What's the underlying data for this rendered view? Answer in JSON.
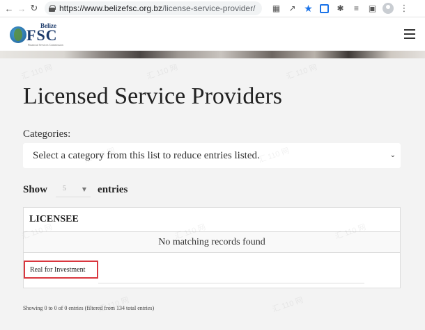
{
  "browser": {
    "url_host": "https://www.belizefsc.org.bz",
    "url_path": "/license-service-provider/"
  },
  "site": {
    "logo_top": "Belize",
    "logo_main": "FSC",
    "logo_tagline": "Financial Services Commission"
  },
  "page": {
    "title": "Licensed Service Providers",
    "categories_label": "Categories:",
    "category_placeholder": "Select a category from this list to reduce entries listed.",
    "show_label": "Show",
    "entries_value": "5",
    "entries_label": "entries"
  },
  "table": {
    "columns": [
      "LICENSEE"
    ],
    "empty_message": "No matching records found",
    "filter_value": "Real for Investment"
  },
  "footer": {
    "info": "Showing 0 to 0 of 0 entries (filtered from 134 total entries)"
  },
  "watermark": "汇 110 网"
}
